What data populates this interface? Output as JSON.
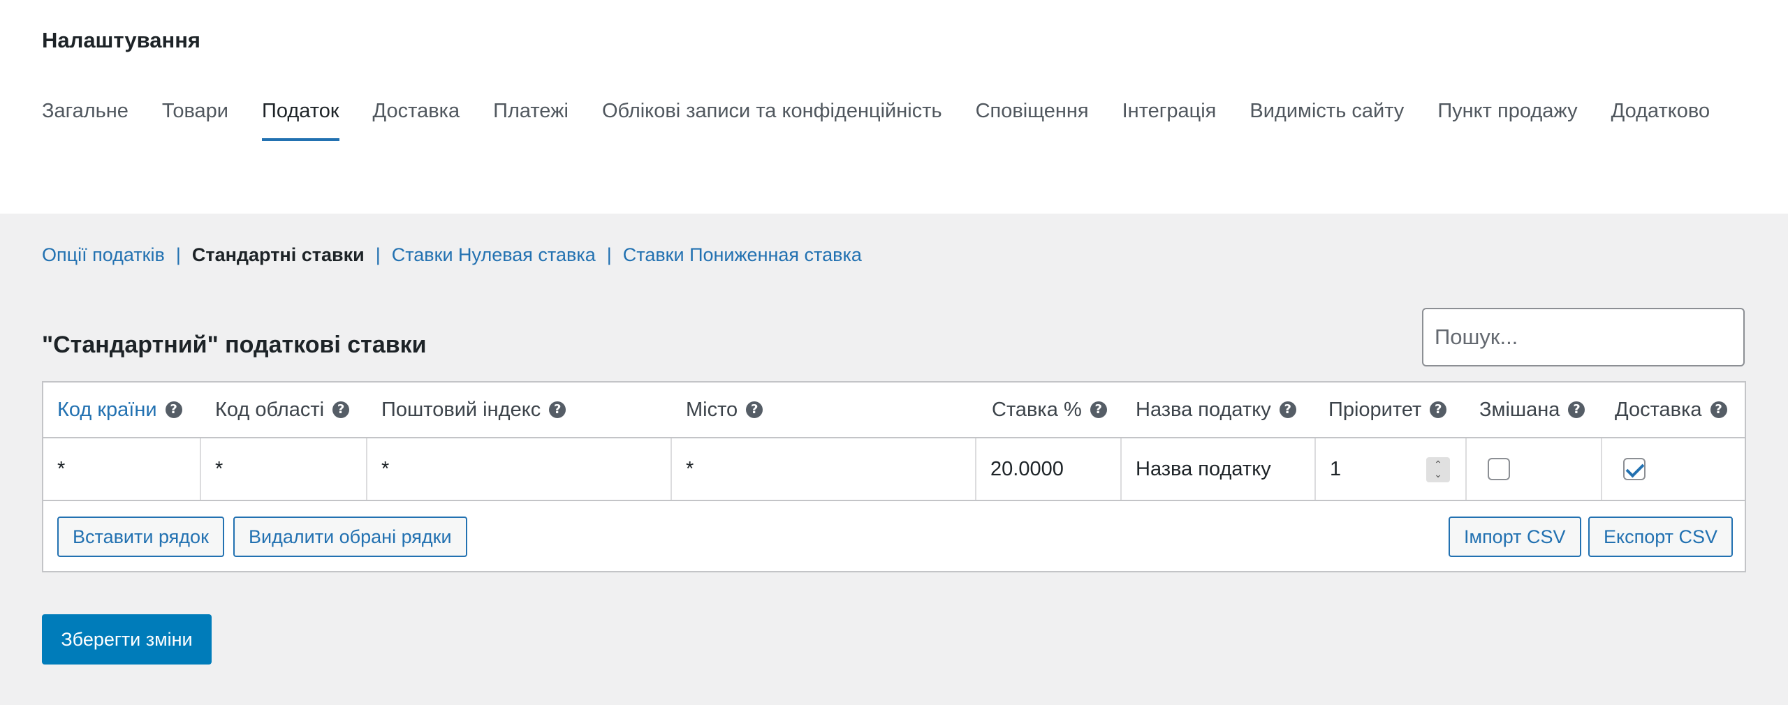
{
  "page": {
    "title": "Налаштування"
  },
  "tabs": [
    {
      "label": "Загальне",
      "active": false
    },
    {
      "label": "Товари",
      "active": false
    },
    {
      "label": "Податок",
      "active": true
    },
    {
      "label": "Доставка",
      "active": false
    },
    {
      "label": "Платежі",
      "active": false
    },
    {
      "label": "Облікові записи та конфіденційність",
      "active": false
    },
    {
      "label": "Сповіщення",
      "active": false
    },
    {
      "label": "Інтеграція",
      "active": false
    },
    {
      "label": "Видимість сайту",
      "active": false
    },
    {
      "label": "Пункт продажу",
      "active": false
    },
    {
      "label": "Додатково",
      "active": false
    }
  ],
  "subnav": {
    "options": "Опції податків",
    "current": "Стандартні ставки",
    "zero": "Ставки Нулевая ставка",
    "reduced": "Ставки Пониженная ставка",
    "separator": "|"
  },
  "section": {
    "title": "\"Стандартний\" податкові ставки"
  },
  "search": {
    "placeholder": "Пошук..."
  },
  "table": {
    "help_glyph": "?",
    "headers": {
      "country": "Код країни",
      "state": "Код області",
      "postcode": "Поштовий індекс",
      "city": "Місто",
      "rate": "Ставка %",
      "name": "Назва податку",
      "priority": "Пріоритет",
      "compound": "Змішана",
      "shipping": "Доставка"
    },
    "rows": [
      {
        "country": "*",
        "state": "*",
        "postcode": "*",
        "city": "*",
        "rate": "20.0000",
        "name": "Назва податку",
        "priority": "1",
        "compound": false,
        "shipping": true
      }
    ],
    "buttons": {
      "insert": "Вставити рядок",
      "remove": "Видалити обрані рядки",
      "import": "Імпорт CSV",
      "export": "Експорт CSV"
    }
  },
  "save": {
    "label": "Зберегти зміни"
  },
  "colors": {
    "accent": "#2271b1",
    "primary_button": "#007cba",
    "background": "#f0f0f1"
  }
}
